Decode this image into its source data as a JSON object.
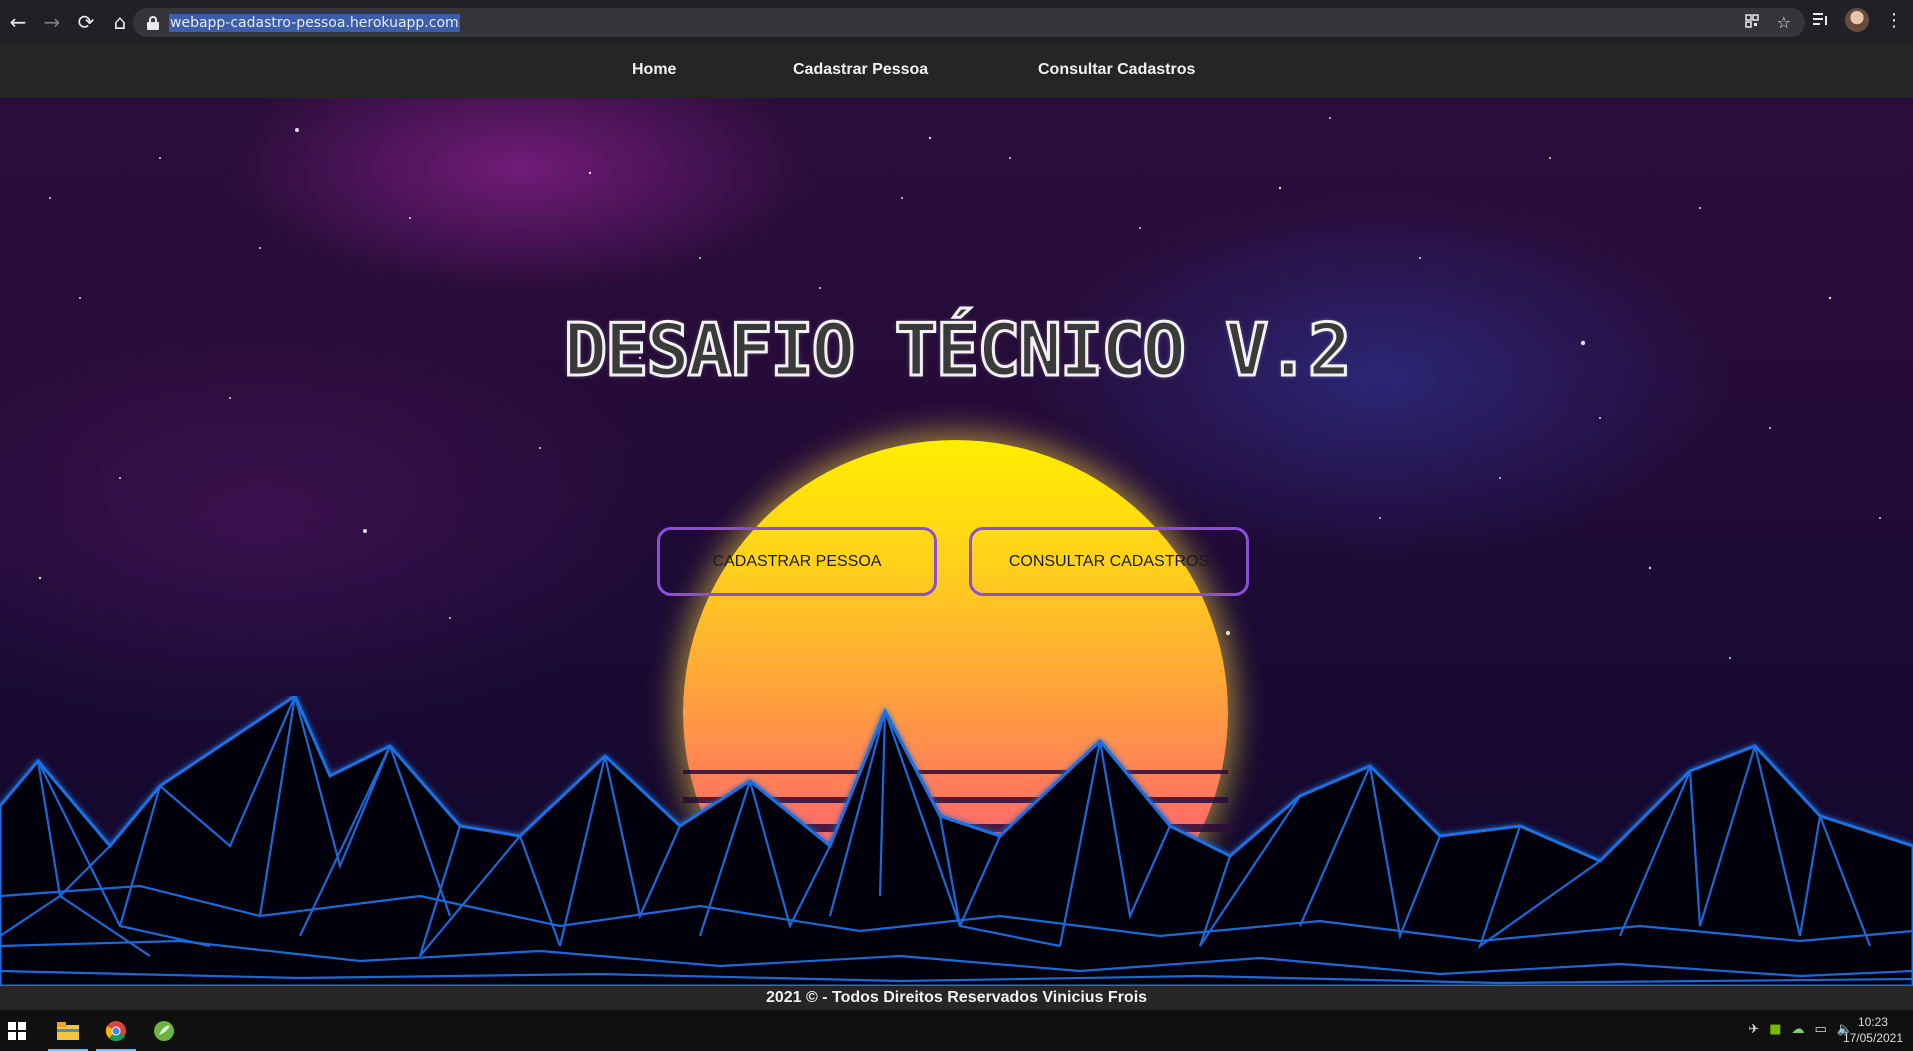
{
  "browser": {
    "url": "webapp-cadastro-pessoa.herokuapp.com",
    "back_icon": "←",
    "forward_icon": "→",
    "reload_icon": "⟳",
    "home_icon": "⌂",
    "star_icon": "☆",
    "menu_icon": "⋮"
  },
  "nav": {
    "home": "Home",
    "cadastrar": "Cadastrar Pessoa",
    "consultar": "Consultar Cadastros"
  },
  "hero": {
    "title": "DESAFIO TÉCNICO V.2",
    "btn_cadastrar": "CADASTRAR PESSOA",
    "btn_consultar": "CONSULTAR CADASTROS"
  },
  "footer": {
    "text": "2021 © - Todos Direitos Reservados Vinicius Frois"
  },
  "taskbar": {
    "time": "10:23",
    "date": "17/05/2021"
  },
  "colors": {
    "button_border": "#8a4fd6",
    "nav_bg": "#252525",
    "grid_line": "#1e6fe0"
  }
}
